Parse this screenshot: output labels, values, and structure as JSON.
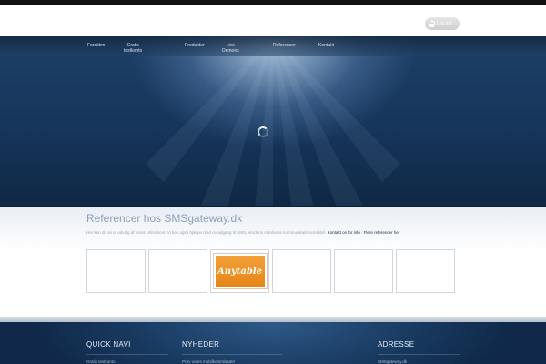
{
  "header": {
    "login_label": "Log ind"
  },
  "nav": {
    "items": [
      {
        "label": "Forsiden"
      },
      {
        "label": "Gratis\ntestkonto"
      },
      {
        "label": "Produkter"
      },
      {
        "label": "Live\nDemoes"
      },
      {
        "label": "Referencer"
      },
      {
        "label": "Kontakt"
      }
    ]
  },
  "content": {
    "title": "Referencer hos SMSgateway.dk",
    "description": "Her kan du se et udvalg af vores referencer. Vi kan også hjælpe med en adgang til SMS, Verdens stærkeste kommunikationsmiddel.",
    "contact_link": "Kontakt os for info",
    "separator": " / ",
    "more_link": "Flere referencer her",
    "logos": [
      {
        "name": ""
      },
      {
        "name": ""
      },
      {
        "name": "Anytable"
      },
      {
        "name": ""
      },
      {
        "name": ""
      },
      {
        "name": ""
      }
    ]
  },
  "footer": {
    "quick_navi": {
      "title": "QUICK NAVI",
      "first_item": "Gratis testkonto"
    },
    "nyheder": {
      "title": "NYHEDER",
      "first_item": "Prøv vores mobilkommissær!"
    },
    "adresse": {
      "title": "ADRESSE",
      "first_item": "SMSgateway.dk"
    }
  },
  "colors": {
    "hero_top": "#1d3f67",
    "accent_orange": "#e58516",
    "title_blue": "#8aa0b8",
    "footer_bg": "#183a60"
  }
}
